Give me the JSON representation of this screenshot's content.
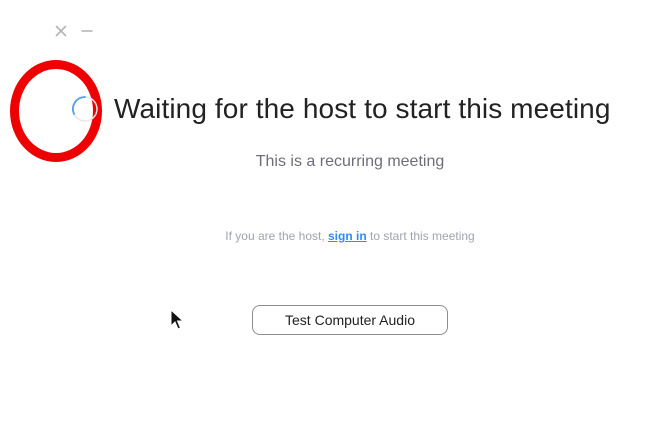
{
  "window": {
    "controls": {
      "close_icon": "close-icon",
      "minimize_icon": "minimize-icon"
    }
  },
  "main": {
    "title": "Waiting for the host to start this meeting",
    "subtitle": "This is a recurring meeting",
    "host_prompt": {
      "before": "If you are the host, ",
      "link": "sign in",
      "after": " to start this meeting"
    },
    "test_audio_label": "Test Computer Audio"
  },
  "colors": {
    "annotation_ring": "#ee0000",
    "link": "#2d8cff",
    "title_text": "#222222",
    "muted_text": "#a0a4ae"
  }
}
